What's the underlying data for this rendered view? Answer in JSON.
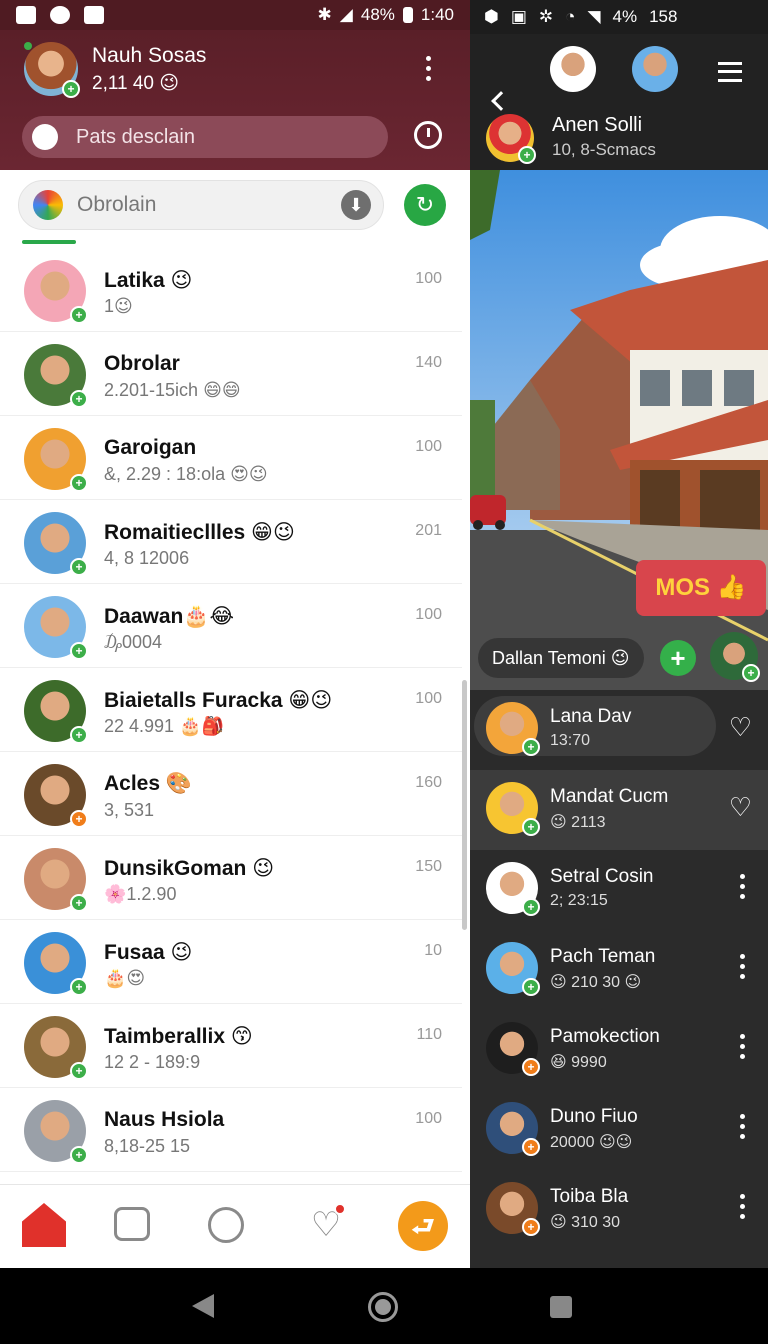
{
  "left_status": {
    "time": "1:40",
    "battery": "48%"
  },
  "profile": {
    "name": "Nauh Sosas",
    "sub": "2,11 40 😉"
  },
  "search": {
    "placeholder": "Pats desclain"
  },
  "filter": {
    "label": "Obrolain"
  },
  "chats": [
    {
      "name": "Latika 😉",
      "preview": "1😉",
      "num": "100"
    },
    {
      "name": "Obrolar",
      "preview": "2.201-15ich 😄😄",
      "num": "140"
    },
    {
      "name": "Garoigan",
      "preview": "&, 2.29 : 18:ola 😍😉",
      "num": "100"
    },
    {
      "name": "Romaitiecllles 😁😉",
      "preview": "4, 8 12006",
      "num": "201"
    },
    {
      "name": "Daawan🎂😂",
      "preview": "₯0004",
      "num": "100"
    },
    {
      "name": "Biaietalls Furacka 😁😉",
      "preview": "22 4.991 🎂🎒",
      "num": "100"
    },
    {
      "name": "Acles 🎨",
      "preview": "3, 531",
      "num": "160"
    },
    {
      "name": "DunsikGoman 😉",
      "preview": "🌸1.2.90",
      "num": "150"
    },
    {
      "name": "Fusaa 😉",
      "preview": "🎂😍",
      "num": "10"
    },
    {
      "name": "Taimberallix 😙",
      "preview": "12 2 - 189:9",
      "num": "110"
    },
    {
      "name": "Naus Hsiola",
      "preview": "8,18-25 15",
      "num": "100"
    }
  ],
  "right_status": {
    "battery": "4%",
    "time": "158"
  },
  "channel": {
    "name": "Anen Solli",
    "sub": "10, 8-Scmacs"
  },
  "photo": {
    "label": "MOS 👍",
    "live_label": "Dallan Temoni 😉",
    "add": "+"
  },
  "right_list": [
    {
      "name": "Lana Dav",
      "sub": "13:70",
      "action": "heart"
    },
    {
      "name": "Mandat Cucm",
      "sub": "😉 2113",
      "action": "heart"
    },
    {
      "name": "Setral Cosin",
      "sub": "2; 23:15",
      "action": "more"
    },
    {
      "name": "Pach Teman",
      "sub": "😉 210 30 😉",
      "action": "more"
    },
    {
      "name": "Pamokection",
      "sub": "😆 9990",
      "action": "more"
    },
    {
      "name": "Duno Fiuo",
      "sub": "20000 😉😉",
      "action": "more"
    },
    {
      "name": "Toiba Bla",
      "sub": "😉 310 30",
      "action": "more"
    }
  ],
  "colors": {
    "header": "#5a1f28",
    "accent_green": "#2aa84a",
    "accent_orange": "#f39a1a",
    "red": "#e0312b"
  }
}
